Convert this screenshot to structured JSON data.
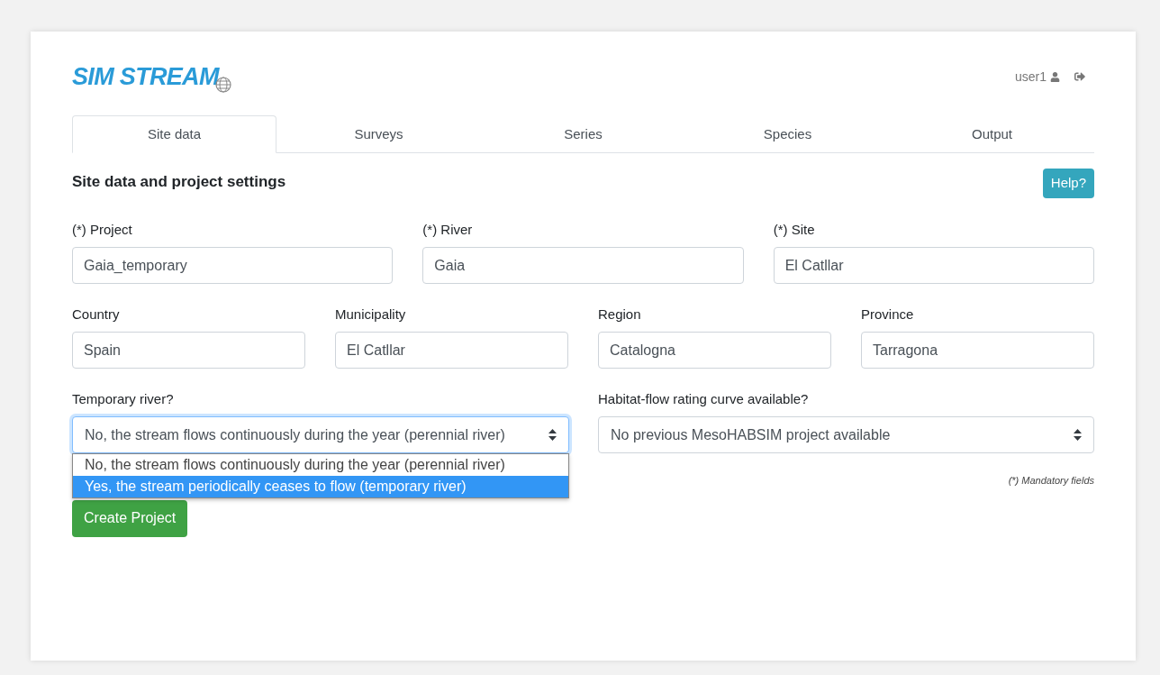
{
  "header": {
    "logo": "SIM STREAM",
    "user": "user1"
  },
  "tabs": [
    {
      "label": "Site data",
      "selected": true
    },
    {
      "label": "Surveys",
      "selected": false
    },
    {
      "label": "Series",
      "selected": false
    },
    {
      "label": "Species",
      "selected": false
    },
    {
      "label": "Output",
      "selected": false
    }
  ],
  "section_title": "Site data and project settings",
  "help_button": "Help?",
  "fields_row_1": [
    {
      "label": "(*) Project",
      "value": "Gaia_temporary"
    },
    {
      "label": "(*) River",
      "value": "Gaia"
    },
    {
      "label": "(*) Site",
      "value": "El Catllar"
    }
  ],
  "fields_row_2": [
    {
      "label": "Country",
      "value": "Spain"
    },
    {
      "label": "Municipality",
      "value": "El Catllar"
    },
    {
      "label": "Region",
      "value": "Catalogna"
    },
    {
      "label": "Province",
      "value": "Tarragona"
    }
  ],
  "temporary_river": {
    "label": "Temporary river?",
    "value": "No, the stream flows continuously during the year (perennial river)",
    "expanded": true,
    "options": [
      {
        "label": "No, the stream flows continuously during the year (perennial river)",
        "highlighted": false
      },
      {
        "label": "Yes, the stream periodically ceases to flow (temporary river)",
        "highlighted": true
      }
    ]
  },
  "rating_curve": {
    "label": "Habitat-flow rating curve available?",
    "value": "No previous MesoHABSIM project available"
  },
  "mandatory_note": "(*) Mandatory fields",
  "create_button": "Create Project"
}
